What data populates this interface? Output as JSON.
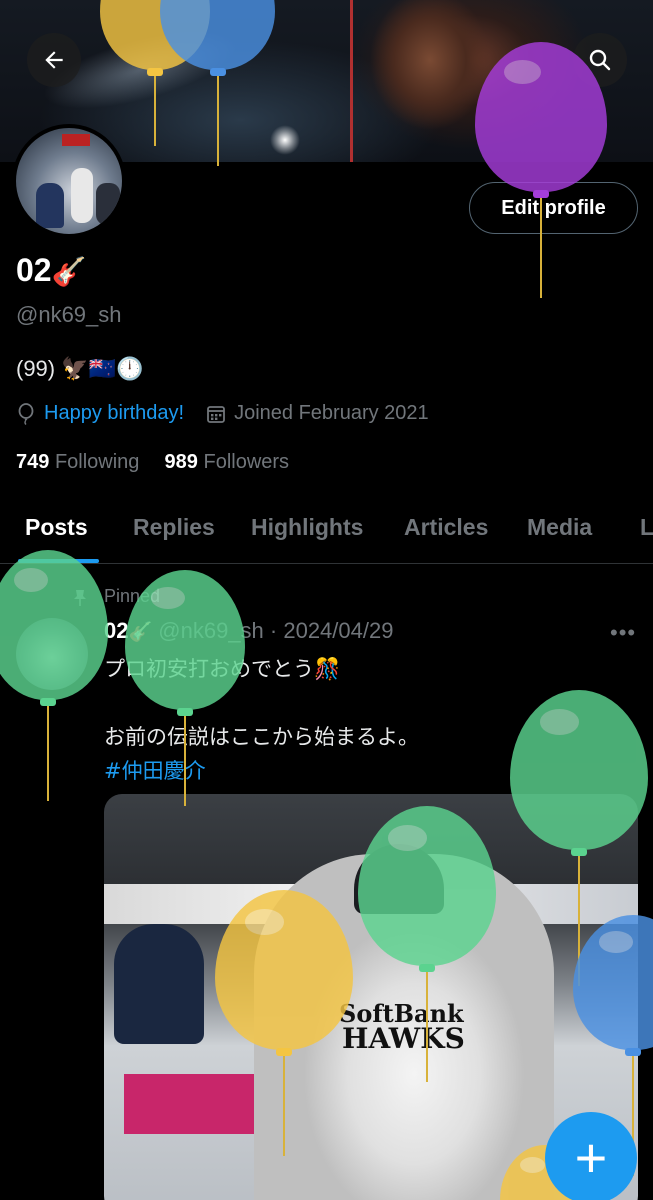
{
  "profile": {
    "name": "02",
    "handle": "@nk69_sh",
    "bio": "(99) 🦅🇳🇿🕛",
    "birthday_link": "Happy birthday!",
    "joined": "Joined February 2021",
    "following_count": "749",
    "following_label": "Following",
    "followers_count": "989",
    "followers_label": "Followers",
    "name_emoji": "🎸"
  },
  "header": {
    "edit_profile_label": "Edit profile"
  },
  "tabs": [
    {
      "label": "Posts",
      "active": true
    },
    {
      "label": "Replies"
    },
    {
      "label": "Highlights"
    },
    {
      "label": "Articles"
    },
    {
      "label": "Media"
    },
    {
      "label": "L"
    }
  ],
  "post": {
    "pinned_label": "Pinned",
    "author": "02",
    "author_emoji": "🎸",
    "meta": "@nk69_sh · 2024/04/29",
    "line1": "プロ初安打おめでとう🎊",
    "line2": "お前の伝説はここから始まるよ。",
    "hashtag": "#仲田慶介",
    "media_text_1": "SoftBank",
    "media_text_2": "HAWKS",
    "more_glyph": "•••"
  },
  "fab": {
    "glyph": "+"
  },
  "colors": {
    "accent": "#1d9bf0",
    "balloon_green": "#5bd38f",
    "balloon_yellow": "#f4c542",
    "balloon_blue": "#4a90e2",
    "balloon_purple": "#a63ddb"
  },
  "icons": [
    "back-arrow-icon",
    "search-icon",
    "balloon-icon",
    "calendar-icon",
    "pin-icon",
    "more-icon",
    "plus-icon"
  ]
}
